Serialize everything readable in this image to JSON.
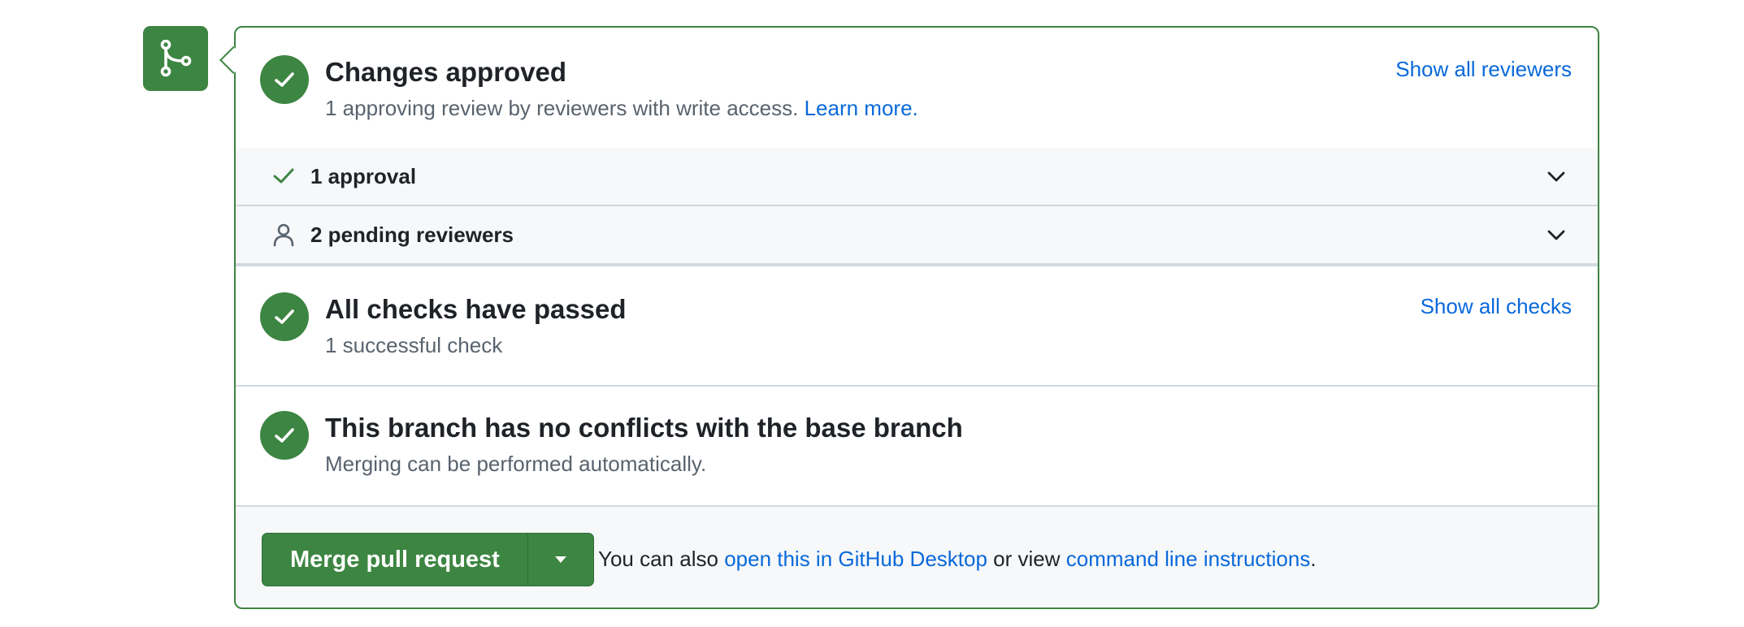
{
  "colors": {
    "success": "#3d8542",
    "link": "#0969da",
    "muted": "#59636e",
    "row_bg": "#f6f8fa"
  },
  "icons": {
    "merge": "git-merge-icon",
    "check": "check-icon",
    "person": "person-icon",
    "chevron": "chevron-down-icon",
    "triangle": "triangle-down-icon"
  },
  "reviews": {
    "title": "Changes approved",
    "subtitle": "1 approving review by reviewers with write access.",
    "learn_more": "Learn more.",
    "show_all": "Show all reviewers",
    "approvals_label": "1 approval",
    "pending_label": "2 pending reviewers"
  },
  "checks": {
    "title": "All checks have passed",
    "subtitle": "1 successful check",
    "show_all": "Show all checks"
  },
  "conflicts": {
    "title": "This branch has no conflicts with the base branch",
    "subtitle": "Merging can be performed automatically."
  },
  "merge": {
    "button_label": "Merge pull request",
    "text_prefix": "You can also",
    "desktop_link": "open this in GitHub Desktop",
    "text_middle": "or view",
    "cli_link": "command line instructions",
    "text_suffix": "."
  }
}
